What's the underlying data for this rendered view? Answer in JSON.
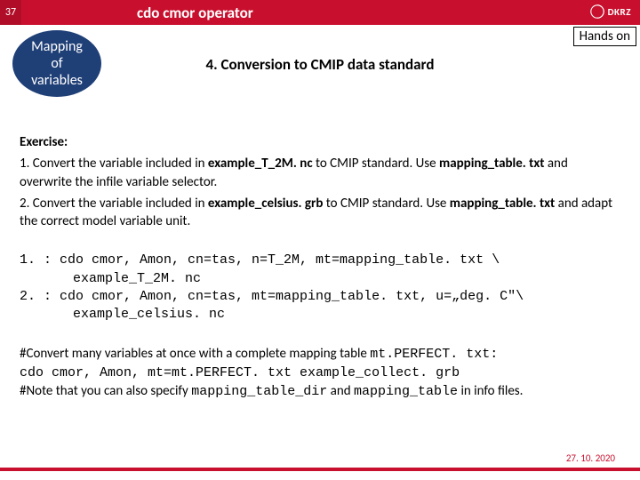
{
  "header": {
    "slide_number": "37",
    "title": "cdo cmor operator",
    "logo_text": "DKRZ"
  },
  "badge": {
    "line1": "Mapping",
    "line2": "of",
    "line3": "variables"
  },
  "hands_on": "Hands on",
  "subtitle": "4. Conversion to CMIP data standard",
  "exercise": {
    "heading": "Exercise:",
    "pre1": "1.   Convert the variable included in ",
    "file1": "example_T_2M. nc",
    "post1a": " to CMIP standard.  Use ",
    "post1b": "mapping_table. txt",
    "post1c": " and overwrite the infile variable selector.",
    "pre2": "2.   Convert the variable included in ",
    "file2": "example_celsius. grb",
    "post2a": " to CMIP standard. Use ",
    "post2b": "mapping_table. txt",
    "post2c": " and adapt the correct model variable unit."
  },
  "commands": {
    "line1": "1. : cdo cmor, Amon, cn=tas, n=T_2M, mt=mapping_table. txt \\",
    "line1b": "example_T_2M. nc",
    "line2": "2. : cdo cmor, Amon, cn=tas, mt=mapping_table. txt, u=„deg. C\"\\",
    "line2b": "example_celsius. nc"
  },
  "note": {
    "l1a": "#Convert many variables at once with a complete mapping table ",
    "l1b": "mt.PERFECT. txt:",
    "l2": "cdo cmor, Amon, mt=mt.PERFECT. txt example_collect. grb",
    "l3a": "#Note that you can also specify ",
    "l3b": "mapping_table_dir",
    "l3c": " and ",
    "l3d": "mapping_table",
    "l3e": " in info files."
  },
  "footer": {
    "date": "27. 10. 2020"
  }
}
